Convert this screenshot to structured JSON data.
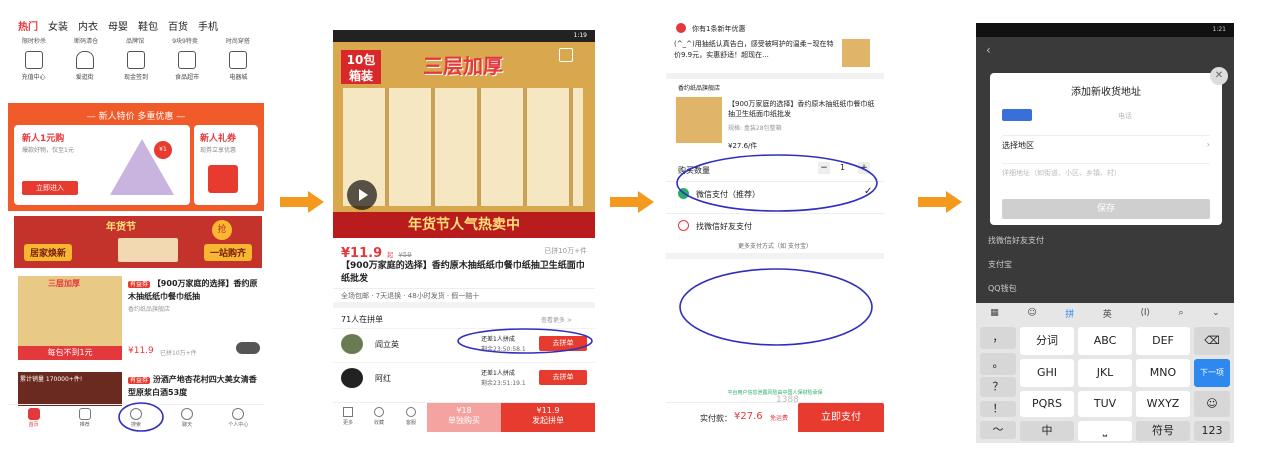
{
  "colors": {
    "accent": "#e4393c",
    "arrow": "#f39a1e",
    "circle": "#2f2fbf",
    "pay": "#e63b2e",
    "kb_blue": "#2d88f0"
  },
  "p1": {
    "tabs": [
      "热门",
      "女装",
      "内衣",
      "母婴",
      "鞋包",
      "百货",
      "手机"
    ],
    "subtabs": [
      "限时秒杀",
      "断码清仓",
      "品牌馆",
      "9块9特卖",
      "时尚穿搭"
    ],
    "icons": [
      {
        "label": "充值中心",
        "icon": "tablet-icon"
      },
      {
        "label": "爱逛街",
        "icon": "dress-icon"
      },
      {
        "label": "现金签到",
        "icon": "calendar-icon"
      },
      {
        "label": "食品超市",
        "icon": "basket-icon"
      },
      {
        "label": "电器城",
        "icon": "appliance-icon"
      }
    ],
    "banner": "— 新人特价 多重优惠 —",
    "new1_title": "新人1元购",
    "new1_sub": "爆款好物，仅至1元",
    "new1_btn": "立即进入",
    "new2_title": "新人礼券",
    "new2_sub": "现券立享优惠",
    "fest_title": "年货节",
    "fest_left": "居家焕新",
    "fest_right": "一站购齐",
    "fest_grab": "抢",
    "item1_tag": "有益券",
    "item1_title": "【900万家庭的选择】香约原木抽纸纸巾餐巾纸抽",
    "item1_shop": "香约纸品旗舰店",
    "item1_price": "¥11.9",
    "item1_sold": "已拼10万+件",
    "item1_img_top": "三层加厚",
    "item1_img_bottom": "每包不到1元",
    "item2_top": "累计销量 170000+件!",
    "item2_tag": "有益券",
    "item2_title": "汾酒产地杏花村四大美女清香型原浆白酒53度",
    "nav": [
      "首页",
      "推荐",
      "搜索",
      "聊天",
      "个人中心"
    ]
  },
  "p2": {
    "status": "1:19",
    "hero_left": "10包箱装",
    "hero_title": "三层加厚",
    "hero_bottom": "年货节人气热卖中",
    "price": "¥11.9",
    "price_unit": "起",
    "old_price": "¥59",
    "sold": "已拼10万+件",
    "title": "【900万家庭的选择】香约原木抽纸纸巾餐巾纸抽卫生纸面巾纸批发",
    "service": "全场包邮 · 7天退换 · 48小时发货 · 假一赔十",
    "group_count": "71人在拼单",
    "group_more": "查看更多 >",
    "groups": [
      {
        "name": "阎立英",
        "need": "还差1人拼成",
        "time": "剩余23:50:58.1",
        "btn": "去拼单"
      },
      {
        "name": "阿红",
        "need": "还差1人拼成",
        "time": "剩余23:51:19.1",
        "btn": "去拼单"
      }
    ],
    "bottom": {
      "more": "更多",
      "fav": "收藏",
      "chat": "客服",
      "solo_price": "¥18",
      "solo": "单独购买",
      "group_price": "¥11.9",
      "group": "发起拼单"
    }
  },
  "p3": {
    "coupon": "你有1条新年优惠",
    "review": "(^_^)用抽纸认真告白，感受被呵护的温柔~现在特价9.9元，实惠舒适！超现在...",
    "shop": "香约纸品旗舰店",
    "item_title": "【900万家庭的选择】香约原木抽纸纸巾餐巾纸抽卫生纸面巾纸批发",
    "item_spec": "规格: 盒装28包整箱",
    "item_price": "¥27.6/件",
    "qty_label": "购买数量",
    "qty": "1",
    "wechat": "微信支付（推荐）",
    "friend": "找微信好友支付",
    "more_pay": "更多支付方式（如 支付宝）",
    "secure": "平台用户信息泄露风险由中国人保财险承保",
    "total_label": "实付款：",
    "total": "¥27.6",
    "total_tag": "免运费",
    "pay_btn": "立即支付",
    "watermark": "1388"
  },
  "p4": {
    "status": "1:21",
    "dialog_title": "添加新收货地址",
    "phone_ph": "电话",
    "region": "选择地区",
    "addr_ph": "详细地址（如街道、小区、乡镇、村）",
    "save": "保存",
    "bg_items": [
      "找微信好友支付",
      "支付宝",
      "QQ钱包"
    ],
    "kb_toolbar": [
      "拼",
      "英"
    ],
    "keys": {
      "r1": [
        "分词",
        "ABC",
        "DEF"
      ],
      "r2": [
        "GHI",
        "JKL",
        "MNO"
      ],
      "r3": [
        "PQRS",
        "TUV",
        "WXYZ"
      ],
      "left": [
        "，",
        "。",
        "？",
        "！",
        "～"
      ],
      "del": "⌫",
      "next": "下一项",
      "emoji": "☺",
      "cn": "中",
      "sym": "符号",
      "num": "123",
      "space": "⎵"
    }
  }
}
